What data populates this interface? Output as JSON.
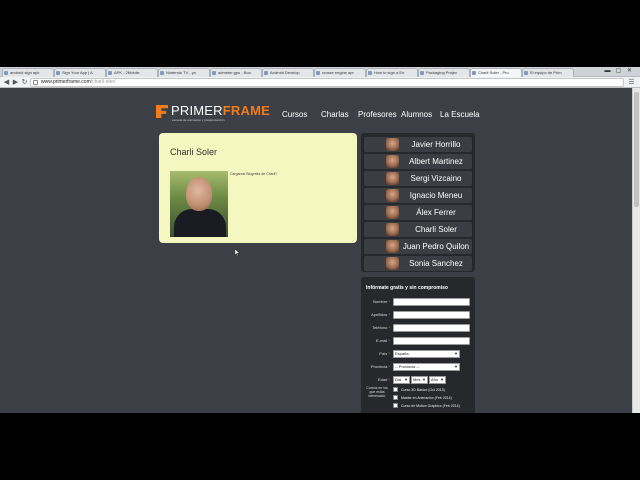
{
  "browser": {
    "tabs": [
      {
        "label": "android sign apk"
      },
      {
        "label": "Sign Your App | A"
      },
      {
        "label": "APK - 2Mobile"
      },
      {
        "label": "Nintendo TV - yo"
      },
      {
        "label": "admeter.gpu - Boo"
      },
      {
        "label": "Android Develop"
      },
      {
        "label": "crosse engine apr"
      },
      {
        "label": "How to sign a En"
      },
      {
        "label": "Packaging Projec"
      },
      {
        "label": "Charli Soler - Pro"
      },
      {
        "label": "El equipo de Prim"
      }
    ],
    "url_domain": "www.primerframe.com",
    "url_path": "/charli-oler/"
  },
  "site": {
    "logo_primer": "PRIMER",
    "logo_frame": "FRAME",
    "logo_tagline": "escuela de animación y postproducción",
    "nav": [
      "Cursos",
      "Charlas",
      "Profesores",
      "Alumnos",
      "La Escuela"
    ]
  },
  "profile": {
    "name": "Charli Soler",
    "bio": "Cargando Biografía de Charli?"
  },
  "teachers": [
    "Javier Horrillo",
    "Albert Martinez",
    "Sergi Vizcaino",
    "Ignacio Meneu",
    "Álex Ferrer",
    "Charli Soler",
    "Juan Pedro Quilon",
    "Sonia Sanchez"
  ],
  "form": {
    "title": "Infórmate gratis y sin compromiso",
    "required_mark": "*",
    "fields": [
      "Nombre",
      "Apellidos",
      "Teléfono",
      "E-mail"
    ],
    "pais_label": "País",
    "pais_value": "España",
    "provincia_label": "Provincia",
    "provincia_value": "-- Provincia --",
    "edad_label": "Edad",
    "edad_dia": "Dia",
    "edad_mes": "Mes",
    "edad_ano": "Año",
    "cursos_label": "Cursos en los que estás interesado:",
    "cursos": [
      "Curso 3D Básico (Oct 2013)",
      "Master en Animación (Feb 2014)",
      "Curso de Motion Graphics (Feb 2014)"
    ]
  }
}
